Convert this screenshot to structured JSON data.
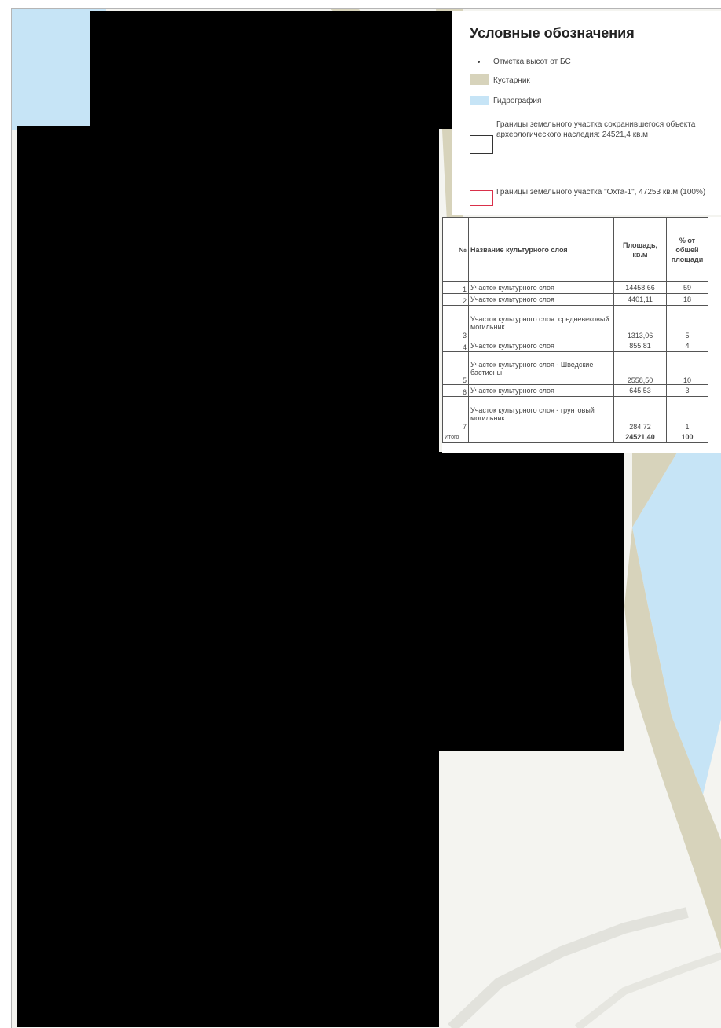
{
  "legend": {
    "title": "Условные обозначения",
    "items": [
      {
        "symbol": "dot-icon",
        "label": "Отметка высот от БС"
      },
      {
        "symbol": "shrub-fill-icon",
        "label": "Кустарник"
      },
      {
        "symbol": "water-fill-icon",
        "label": "Гидрография"
      },
      {
        "symbol": "black-outline-icon",
        "label": "Границы земельного участка сохранившегося объекта археологического наследия: 24521,4 кв.м"
      },
      {
        "symbol": "red-outline-icon",
        "label": "Границы земельного участка \"Охта-1\", 47253 кв.м (100%)"
      }
    ]
  },
  "table": {
    "headers": {
      "num": "№",
      "name": "Название культурного слоя",
      "area": "Площадь, кв.м",
      "pct": "% от общей площади"
    },
    "rows": [
      {
        "num": "1",
        "name": "Участок культурного слоя",
        "area": "14458,66",
        "pct": "59"
      },
      {
        "num": "2",
        "name": "Участок культурного слоя",
        "area": "4401,11",
        "pct": "18"
      },
      {
        "num": "3",
        "name": "Участок культурного слоя: средневековый могильник",
        "area": "1313,06",
        "pct": "5"
      },
      {
        "num": "4",
        "name": "Участок культурного слоя",
        "area": "855,81",
        "pct": "4"
      },
      {
        "num": "5",
        "name": "Участок культурного слоя - Шведские бастионы",
        "area": "2558,50",
        "pct": "10"
      },
      {
        "num": "6",
        "name": "Участок культурного слоя",
        "area": "645,53",
        "pct": "3"
      },
      {
        "num": "7",
        "name": "Участок культурного слоя - грунтовый могильник",
        "area": "284,72",
        "pct": "1"
      }
    ],
    "total": {
      "num": "Итого",
      "name": "",
      "area": "24521,40",
      "pct": "100"
    }
  },
  "colors": {
    "shrub": "#d7d3bb",
    "water": "#c6e4f6",
    "site_boundary": "#333333",
    "plot_boundary": "#d9304a",
    "redaction": "#000000"
  }
}
